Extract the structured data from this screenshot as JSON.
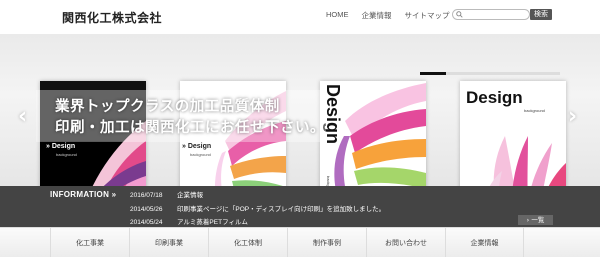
{
  "header": {
    "logo": "関西化工株式会社",
    "nav": [
      "HOME",
      "企業情報",
      "サイトマップ"
    ],
    "search_placeholder": "",
    "search_button": "検索"
  },
  "slider": {
    "headline_line1": "業界トップクラスの加工品質体制",
    "headline_line2": "印刷・加工は関西化工にお任せ下さい。",
    "prev_arrow": "‹",
    "next_arrow": "›",
    "covers": [
      {
        "title": "» Design",
        "subtitle": "background"
      },
      {
        "title": "» Design",
        "subtitle": "background"
      },
      {
        "title": "Design",
        "subtitle": "background"
      },
      {
        "title": "Design",
        "subtitle": "background"
      }
    ]
  },
  "info": {
    "title": "INFORMATION »",
    "items": [
      {
        "date": "2016/07/18",
        "text": "企業情報"
      },
      {
        "date": "2014/05/26",
        "text": "印刷事業ページに「POP・ディスプレイ向け印刷」を追加致しました。"
      },
      {
        "date": "2014/05/24",
        "text": "アルミ蒸着PETフィルム"
      }
    ],
    "more_button": "› 一覧"
  },
  "bottom_nav": [
    "化工事業",
    "印刷事業",
    "化工体制",
    "制作事例",
    "お問い合わせ",
    "企業情報"
  ]
}
